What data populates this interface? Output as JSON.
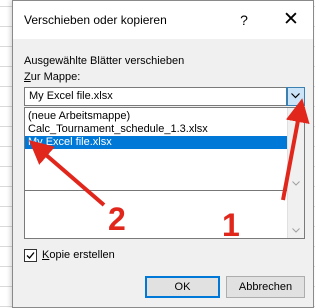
{
  "dialog": {
    "title": "Verschieben oder kopieren",
    "help_glyph": "?",
    "close_glyph": "✕",
    "move_label": "Ausgewählte Blätter verschieben",
    "to_book_label": "Zur Mappe:",
    "combo_value": "My Excel file.xlsx",
    "list_items": [
      "(neue Arbeitsmappe)",
      "Calc_Tournament_schedule_1.3.xlsx",
      "My Excel file.xlsx"
    ],
    "selected_index": 2,
    "copy_checkbox_label": "Kopie erstellen",
    "copy_checked": true,
    "ok_label": "OK",
    "cancel_label": "Abbrechen"
  },
  "annotations": {
    "arrow1_number": "1",
    "arrow2_number": "2",
    "color": "#e1261c"
  },
  "colors": {
    "selection": "#0078d7",
    "dialog_bg": "#f0f0f0"
  }
}
